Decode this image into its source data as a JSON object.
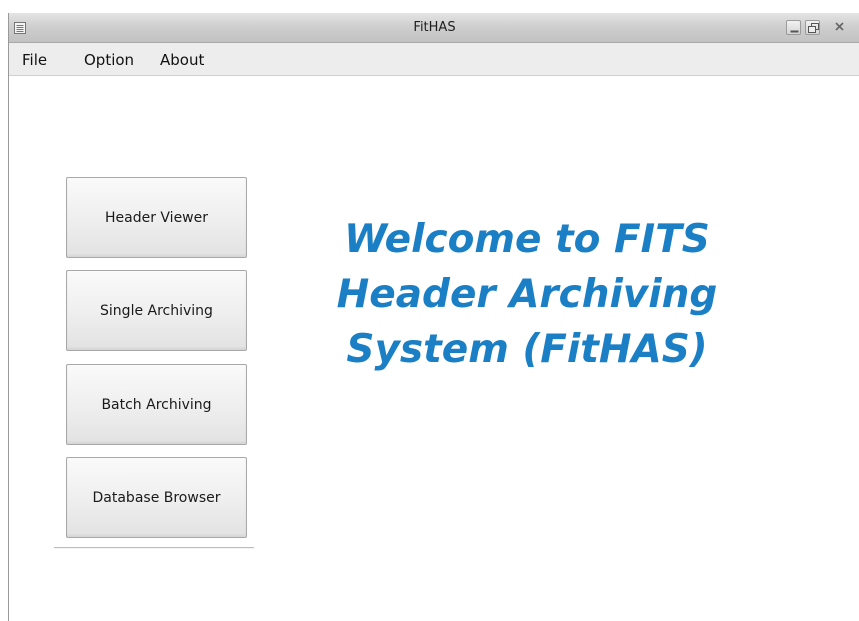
{
  "window": {
    "title": "FitHAS",
    "controls": {
      "minimize_icon": "minimize-icon",
      "maximize_icon": "maximize-icon",
      "close_icon": "close-icon"
    }
  },
  "menubar": {
    "items": [
      {
        "label": "File"
      },
      {
        "label": "Option"
      },
      {
        "label": "About"
      }
    ]
  },
  "sidebar": {
    "buttons": [
      {
        "label": "Header Viewer"
      },
      {
        "label": "Single Archiving"
      },
      {
        "label": "Batch Archiving"
      },
      {
        "label": "Database Browser"
      }
    ]
  },
  "main": {
    "welcome_text": "Welcome to FITS\nHeader Archiving\nSystem (FitHAS)"
  },
  "colors": {
    "welcome_text": "#1a7fc4",
    "menubar_bg": "#ededed",
    "titlebar_bg": "#cfcfcf"
  }
}
